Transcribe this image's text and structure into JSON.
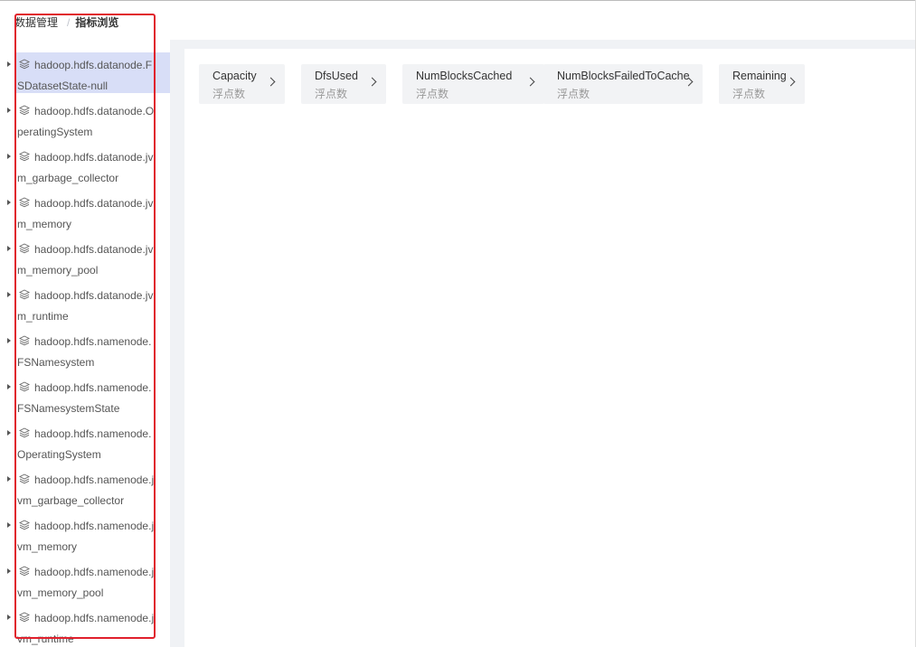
{
  "breadcrumb": {
    "root": "数据管理",
    "separator": "/",
    "current": "指标浏览"
  },
  "sidebar": {
    "partial_top": "...",
    "items": [
      {
        "label": "hadoop.hdfs.datanode.FSDatasetState-null",
        "selected": true
      },
      {
        "label": "hadoop.hdfs.datanode.OperatingSystem",
        "selected": false
      },
      {
        "label": "hadoop.hdfs.datanode.jvm_garbage_collector",
        "selected": false
      },
      {
        "label": "hadoop.hdfs.datanode.jvm_memory",
        "selected": false
      },
      {
        "label": "hadoop.hdfs.datanode.jvm_memory_pool",
        "selected": false
      },
      {
        "label": "hadoop.hdfs.datanode.jvm_runtime",
        "selected": false
      },
      {
        "label": "hadoop.hdfs.namenode.FSNamesystem",
        "selected": false
      },
      {
        "label": "hadoop.hdfs.namenode.FSNamesystemState",
        "selected": false
      },
      {
        "label": "hadoop.hdfs.namenode.OperatingSystem",
        "selected": false
      },
      {
        "label": "hadoop.hdfs.namenode.jvm_garbage_collector",
        "selected": false
      },
      {
        "label": "hadoop.hdfs.namenode.jvm_memory",
        "selected": false
      },
      {
        "label": "hadoop.hdfs.namenode.jvm_memory_pool",
        "selected": false
      },
      {
        "label": "hadoop.hdfs.namenode.jvm_runtime",
        "selected": false
      }
    ]
  },
  "metrics": [
    {
      "name": "Capacity",
      "type": "浮点数"
    },
    {
      "name": "DfsUsed",
      "type": "浮点数"
    },
    {
      "name": "NumBlocksCached",
      "type": "浮点数"
    },
    {
      "name": "NumBlocksFailedToCache",
      "type": "浮点数"
    },
    {
      "name": "Remaining",
      "type": "浮点数"
    }
  ],
  "colors": {
    "highlight": "#d8def7",
    "annotation": "#e0202c",
    "card_bg": "#f2f3f5"
  },
  "icons": {
    "tree_item": "layers-icon",
    "tree_toggle": "caret-right-icon",
    "card": "chevron-right-icon"
  }
}
